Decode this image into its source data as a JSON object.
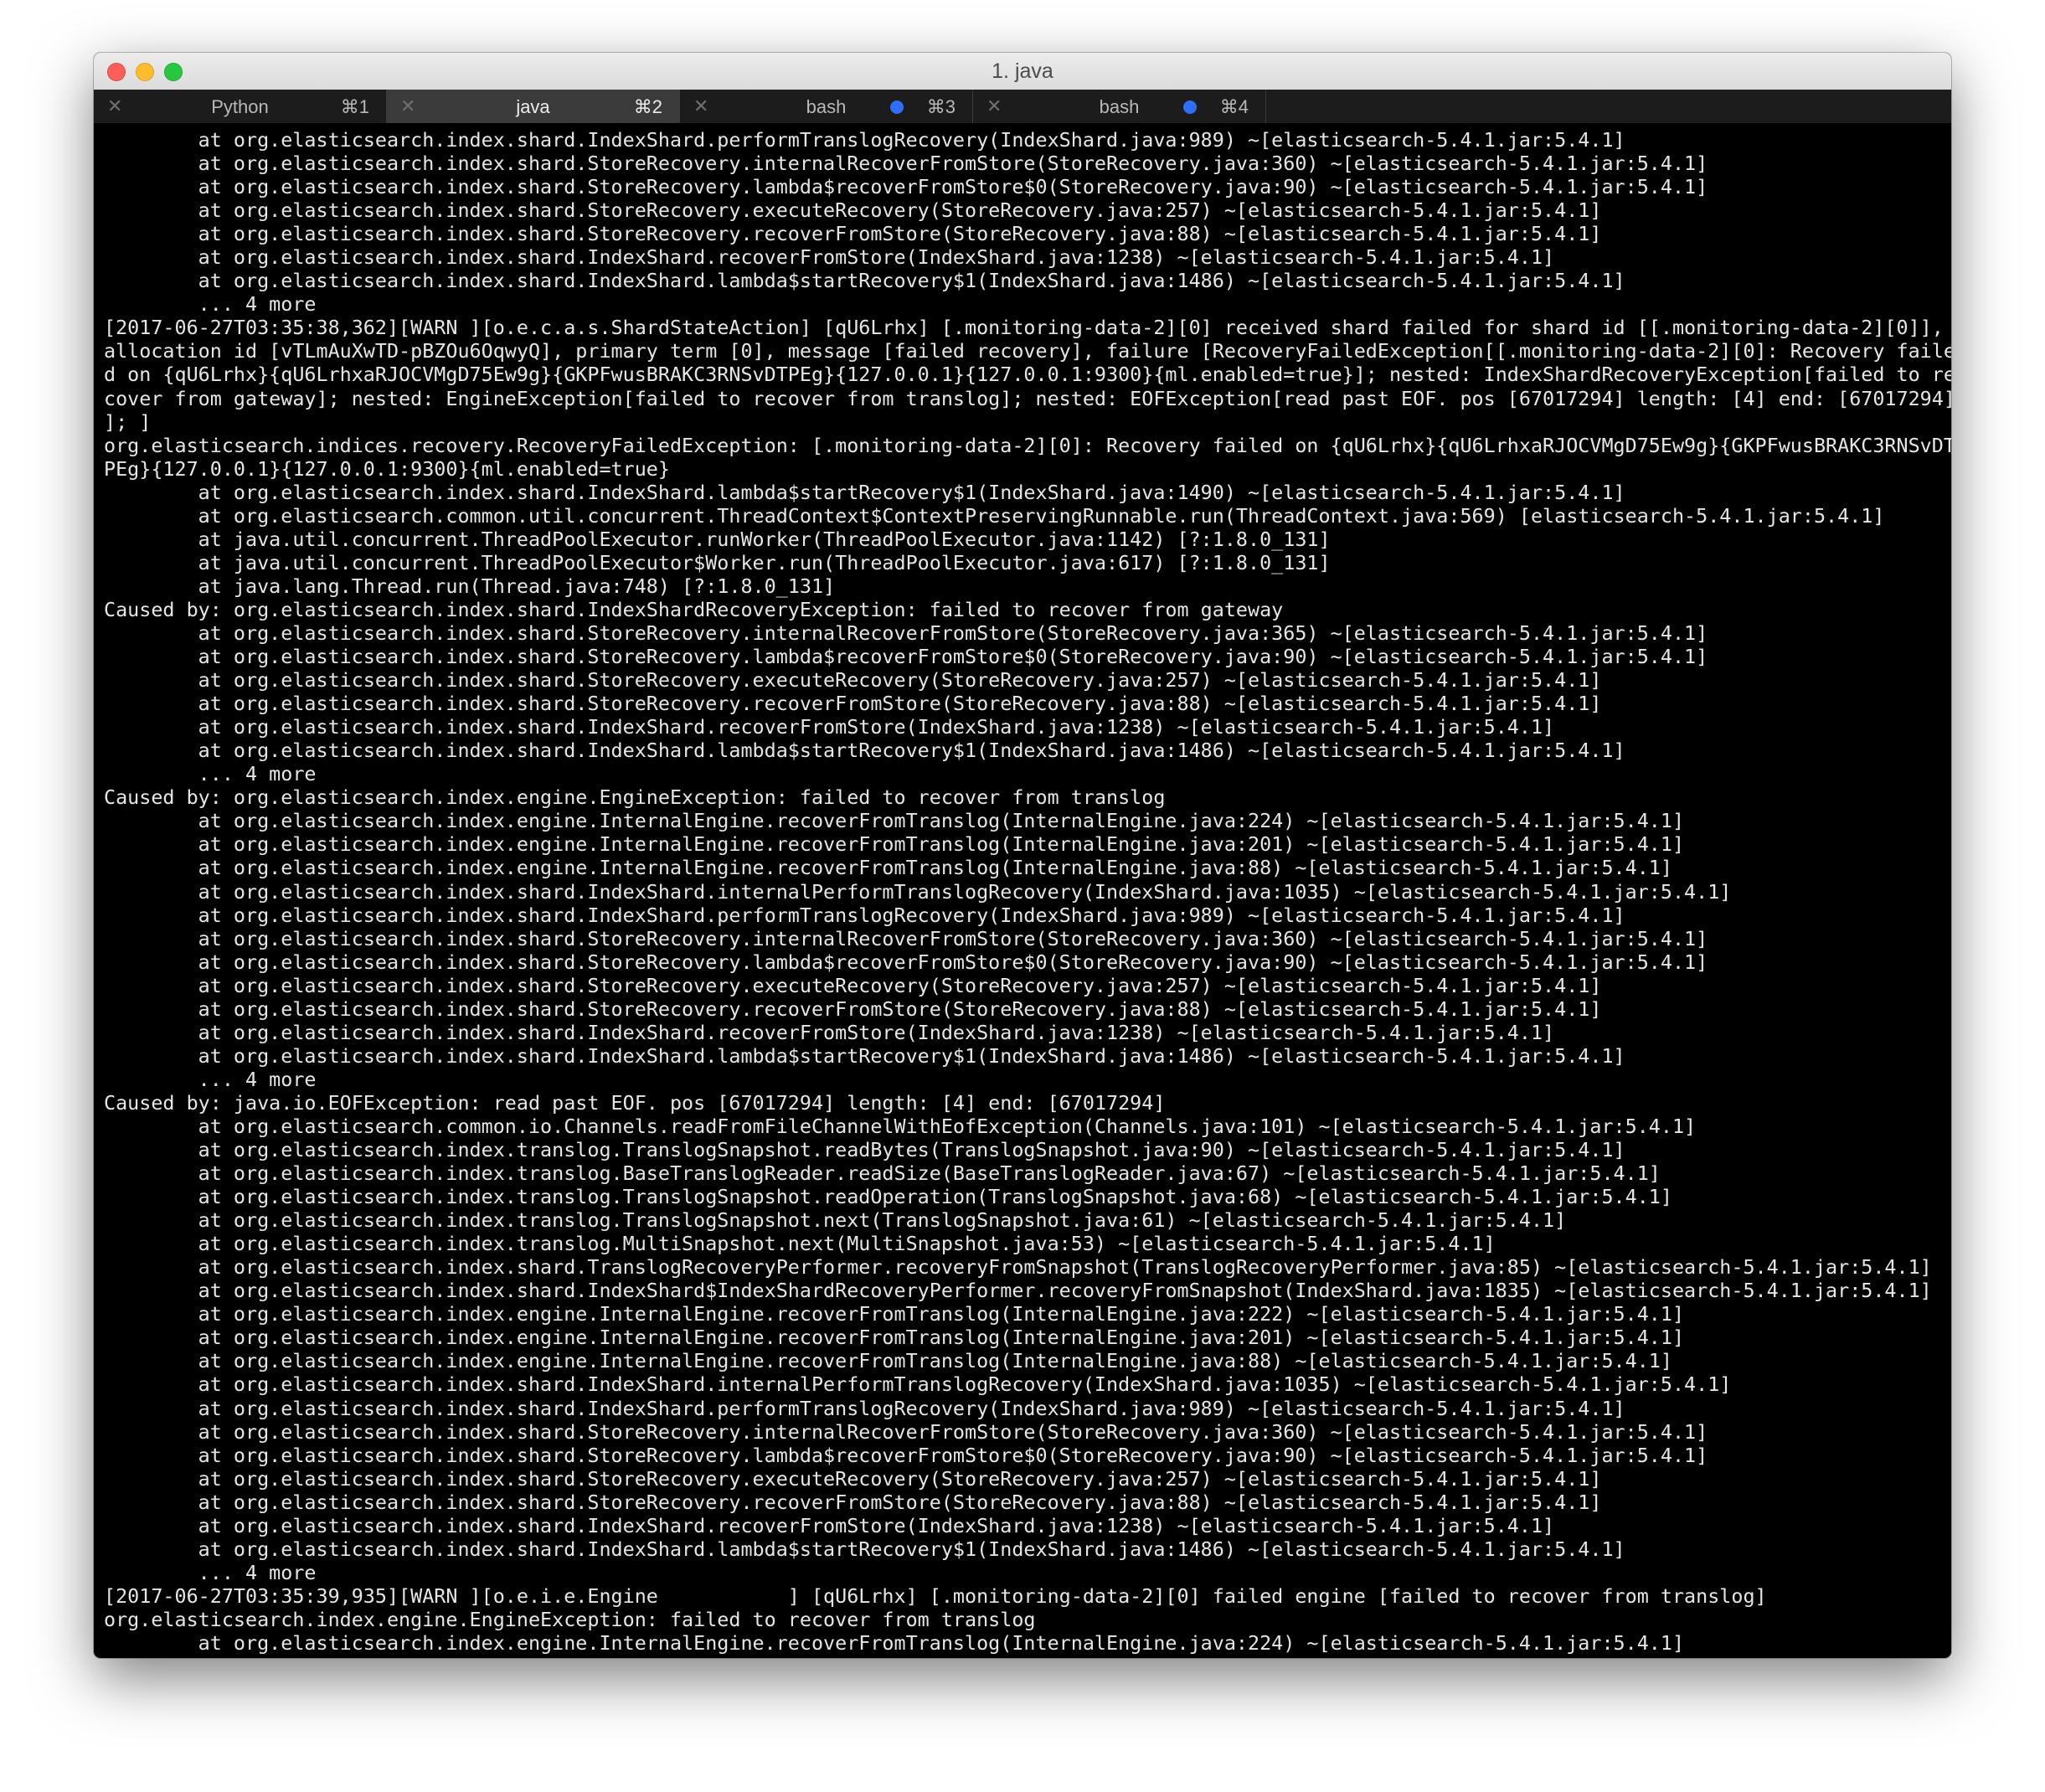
{
  "window": {
    "title": "1. java"
  },
  "tabs": [
    {
      "label": "Python",
      "shortcut": "⌘1",
      "active": false,
      "dot": false
    },
    {
      "label": "java",
      "shortcut": "⌘2",
      "active": true,
      "dot": false
    },
    {
      "label": "bash",
      "shortcut": "⌘3",
      "active": false,
      "dot": true
    },
    {
      "label": "bash",
      "shortcut": "⌘4",
      "active": false,
      "dot": true
    }
  ],
  "colors": {
    "terminal_bg": "#000000",
    "terminal_fg": "#e6e6e6",
    "activity_dot": "#2f6ff6"
  },
  "terminal_lines": [
    "        at org.elasticsearch.index.shard.IndexShard.performTranslogRecovery(IndexShard.java:989) ~[elasticsearch-5.4.1.jar:5.4.1]",
    "        at org.elasticsearch.index.shard.StoreRecovery.internalRecoverFromStore(StoreRecovery.java:360) ~[elasticsearch-5.4.1.jar:5.4.1]",
    "        at org.elasticsearch.index.shard.StoreRecovery.lambda$recoverFromStore$0(StoreRecovery.java:90) ~[elasticsearch-5.4.1.jar:5.4.1]",
    "        at org.elasticsearch.index.shard.StoreRecovery.executeRecovery(StoreRecovery.java:257) ~[elasticsearch-5.4.1.jar:5.4.1]",
    "        at org.elasticsearch.index.shard.StoreRecovery.recoverFromStore(StoreRecovery.java:88) ~[elasticsearch-5.4.1.jar:5.4.1]",
    "        at org.elasticsearch.index.shard.IndexShard.recoverFromStore(IndexShard.java:1238) ~[elasticsearch-5.4.1.jar:5.4.1]",
    "        at org.elasticsearch.index.shard.IndexShard.lambda$startRecovery$1(IndexShard.java:1486) ~[elasticsearch-5.4.1.jar:5.4.1]",
    "        ... 4 more",
    "[2017-06-27T03:35:38,362][WARN ][o.e.c.a.s.ShardStateAction] [qU6Lrhx] [.monitoring-data-2][0] received shard failed for shard id [[.monitoring-data-2][0]],",
    "allocation id [vTLmAuXwTD-pBZOu6OqwyQ], primary term [0], message [failed recovery], failure [RecoveryFailedException[[.monitoring-data-2][0]: Recovery faile",
    "d on {qU6Lrhx}{qU6LrhxaRJOCVMgD75Ew9g}{GKPFwusBRAKC3RNSvDTPEg}{127.0.0.1}{127.0.0.1:9300}{ml.enabled=true}]; nested: IndexShardRecoveryException[failed to re",
    "cover from gateway]; nested: EngineException[failed to recover from translog]; nested: EOFException[read past EOF. pos [67017294] length: [4] end: [67017294]",
    "]; ]",
    "org.elasticsearch.indices.recovery.RecoveryFailedException: [.monitoring-data-2][0]: Recovery failed on {qU6Lrhx}{qU6LrhxaRJOCVMgD75Ew9g}{GKPFwusBRAKC3RNSvDT",
    "PEg}{127.0.0.1}{127.0.0.1:9300}{ml.enabled=true}",
    "        at org.elasticsearch.index.shard.IndexShard.lambda$startRecovery$1(IndexShard.java:1490) ~[elasticsearch-5.4.1.jar:5.4.1]",
    "        at org.elasticsearch.common.util.concurrent.ThreadContext$ContextPreservingRunnable.run(ThreadContext.java:569) [elasticsearch-5.4.1.jar:5.4.1]",
    "        at java.util.concurrent.ThreadPoolExecutor.runWorker(ThreadPoolExecutor.java:1142) [?:1.8.0_131]",
    "        at java.util.concurrent.ThreadPoolExecutor$Worker.run(ThreadPoolExecutor.java:617) [?:1.8.0_131]",
    "        at java.lang.Thread.run(Thread.java:748) [?:1.8.0_131]",
    "Caused by: org.elasticsearch.index.shard.IndexShardRecoveryException: failed to recover from gateway",
    "        at org.elasticsearch.index.shard.StoreRecovery.internalRecoverFromStore(StoreRecovery.java:365) ~[elasticsearch-5.4.1.jar:5.4.1]",
    "        at org.elasticsearch.index.shard.StoreRecovery.lambda$recoverFromStore$0(StoreRecovery.java:90) ~[elasticsearch-5.4.1.jar:5.4.1]",
    "        at org.elasticsearch.index.shard.StoreRecovery.executeRecovery(StoreRecovery.java:257) ~[elasticsearch-5.4.1.jar:5.4.1]",
    "        at org.elasticsearch.index.shard.StoreRecovery.recoverFromStore(StoreRecovery.java:88) ~[elasticsearch-5.4.1.jar:5.4.1]",
    "        at org.elasticsearch.index.shard.IndexShard.recoverFromStore(IndexShard.java:1238) ~[elasticsearch-5.4.1.jar:5.4.1]",
    "        at org.elasticsearch.index.shard.IndexShard.lambda$startRecovery$1(IndexShard.java:1486) ~[elasticsearch-5.4.1.jar:5.4.1]",
    "        ... 4 more",
    "Caused by: org.elasticsearch.index.engine.EngineException: failed to recover from translog",
    "        at org.elasticsearch.index.engine.InternalEngine.recoverFromTranslog(InternalEngine.java:224) ~[elasticsearch-5.4.1.jar:5.4.1]",
    "        at org.elasticsearch.index.engine.InternalEngine.recoverFromTranslog(InternalEngine.java:201) ~[elasticsearch-5.4.1.jar:5.4.1]",
    "        at org.elasticsearch.index.engine.InternalEngine.recoverFromTranslog(InternalEngine.java:88) ~[elasticsearch-5.4.1.jar:5.4.1]",
    "        at org.elasticsearch.index.shard.IndexShard.internalPerformTranslogRecovery(IndexShard.java:1035) ~[elasticsearch-5.4.1.jar:5.4.1]",
    "        at org.elasticsearch.index.shard.IndexShard.performTranslogRecovery(IndexShard.java:989) ~[elasticsearch-5.4.1.jar:5.4.1]",
    "        at org.elasticsearch.index.shard.StoreRecovery.internalRecoverFromStore(StoreRecovery.java:360) ~[elasticsearch-5.4.1.jar:5.4.1]",
    "        at org.elasticsearch.index.shard.StoreRecovery.lambda$recoverFromStore$0(StoreRecovery.java:90) ~[elasticsearch-5.4.1.jar:5.4.1]",
    "        at org.elasticsearch.index.shard.StoreRecovery.executeRecovery(StoreRecovery.java:257) ~[elasticsearch-5.4.1.jar:5.4.1]",
    "        at org.elasticsearch.index.shard.StoreRecovery.recoverFromStore(StoreRecovery.java:88) ~[elasticsearch-5.4.1.jar:5.4.1]",
    "        at org.elasticsearch.index.shard.IndexShard.recoverFromStore(IndexShard.java:1238) ~[elasticsearch-5.4.1.jar:5.4.1]",
    "        at org.elasticsearch.index.shard.IndexShard.lambda$startRecovery$1(IndexShard.java:1486) ~[elasticsearch-5.4.1.jar:5.4.1]",
    "        ... 4 more",
    "Caused by: java.io.EOFException: read past EOF. pos [67017294] length: [4] end: [67017294]",
    "        at org.elasticsearch.common.io.Channels.readFromFileChannelWithEofException(Channels.java:101) ~[elasticsearch-5.4.1.jar:5.4.1]",
    "        at org.elasticsearch.index.translog.TranslogSnapshot.readBytes(TranslogSnapshot.java:90) ~[elasticsearch-5.4.1.jar:5.4.1]",
    "        at org.elasticsearch.index.translog.BaseTranslogReader.readSize(BaseTranslogReader.java:67) ~[elasticsearch-5.4.1.jar:5.4.1]",
    "        at org.elasticsearch.index.translog.TranslogSnapshot.readOperation(TranslogSnapshot.java:68) ~[elasticsearch-5.4.1.jar:5.4.1]",
    "        at org.elasticsearch.index.translog.TranslogSnapshot.next(TranslogSnapshot.java:61) ~[elasticsearch-5.4.1.jar:5.4.1]",
    "        at org.elasticsearch.index.translog.MultiSnapshot.next(MultiSnapshot.java:53) ~[elasticsearch-5.4.1.jar:5.4.1]",
    "        at org.elasticsearch.index.shard.TranslogRecoveryPerformer.recoveryFromSnapshot(TranslogRecoveryPerformer.java:85) ~[elasticsearch-5.4.1.jar:5.4.1]",
    "        at org.elasticsearch.index.shard.IndexShard$IndexShardRecoveryPerformer.recoveryFromSnapshot(IndexShard.java:1835) ~[elasticsearch-5.4.1.jar:5.4.1]",
    "        at org.elasticsearch.index.engine.InternalEngine.recoverFromTranslog(InternalEngine.java:222) ~[elasticsearch-5.4.1.jar:5.4.1]",
    "        at org.elasticsearch.index.engine.InternalEngine.recoverFromTranslog(InternalEngine.java:201) ~[elasticsearch-5.4.1.jar:5.4.1]",
    "        at org.elasticsearch.index.engine.InternalEngine.recoverFromTranslog(InternalEngine.java:88) ~[elasticsearch-5.4.1.jar:5.4.1]",
    "        at org.elasticsearch.index.shard.IndexShard.internalPerformTranslogRecovery(IndexShard.java:1035) ~[elasticsearch-5.4.1.jar:5.4.1]",
    "        at org.elasticsearch.index.shard.IndexShard.performTranslogRecovery(IndexShard.java:989) ~[elasticsearch-5.4.1.jar:5.4.1]",
    "        at org.elasticsearch.index.shard.StoreRecovery.internalRecoverFromStore(StoreRecovery.java:360) ~[elasticsearch-5.4.1.jar:5.4.1]",
    "        at org.elasticsearch.index.shard.StoreRecovery.lambda$recoverFromStore$0(StoreRecovery.java:90) ~[elasticsearch-5.4.1.jar:5.4.1]",
    "        at org.elasticsearch.index.shard.StoreRecovery.executeRecovery(StoreRecovery.java:257) ~[elasticsearch-5.4.1.jar:5.4.1]",
    "        at org.elasticsearch.index.shard.StoreRecovery.recoverFromStore(StoreRecovery.java:88) ~[elasticsearch-5.4.1.jar:5.4.1]",
    "        at org.elasticsearch.index.shard.IndexShard.recoverFromStore(IndexShard.java:1238) ~[elasticsearch-5.4.1.jar:5.4.1]",
    "        at org.elasticsearch.index.shard.IndexShard.lambda$startRecovery$1(IndexShard.java:1486) ~[elasticsearch-5.4.1.jar:5.4.1]",
    "        ... 4 more",
    "[2017-06-27T03:35:39,935][WARN ][o.e.i.e.Engine           ] [qU6Lrhx] [.monitoring-data-2][0] failed engine [failed to recover from translog]",
    "org.elasticsearch.index.engine.EngineException: failed to recover from translog",
    "        at org.elasticsearch.index.engine.InternalEngine.recoverFromTranslog(InternalEngine.java:224) ~[elasticsearch-5.4.1.jar:5.4.1]"
  ]
}
